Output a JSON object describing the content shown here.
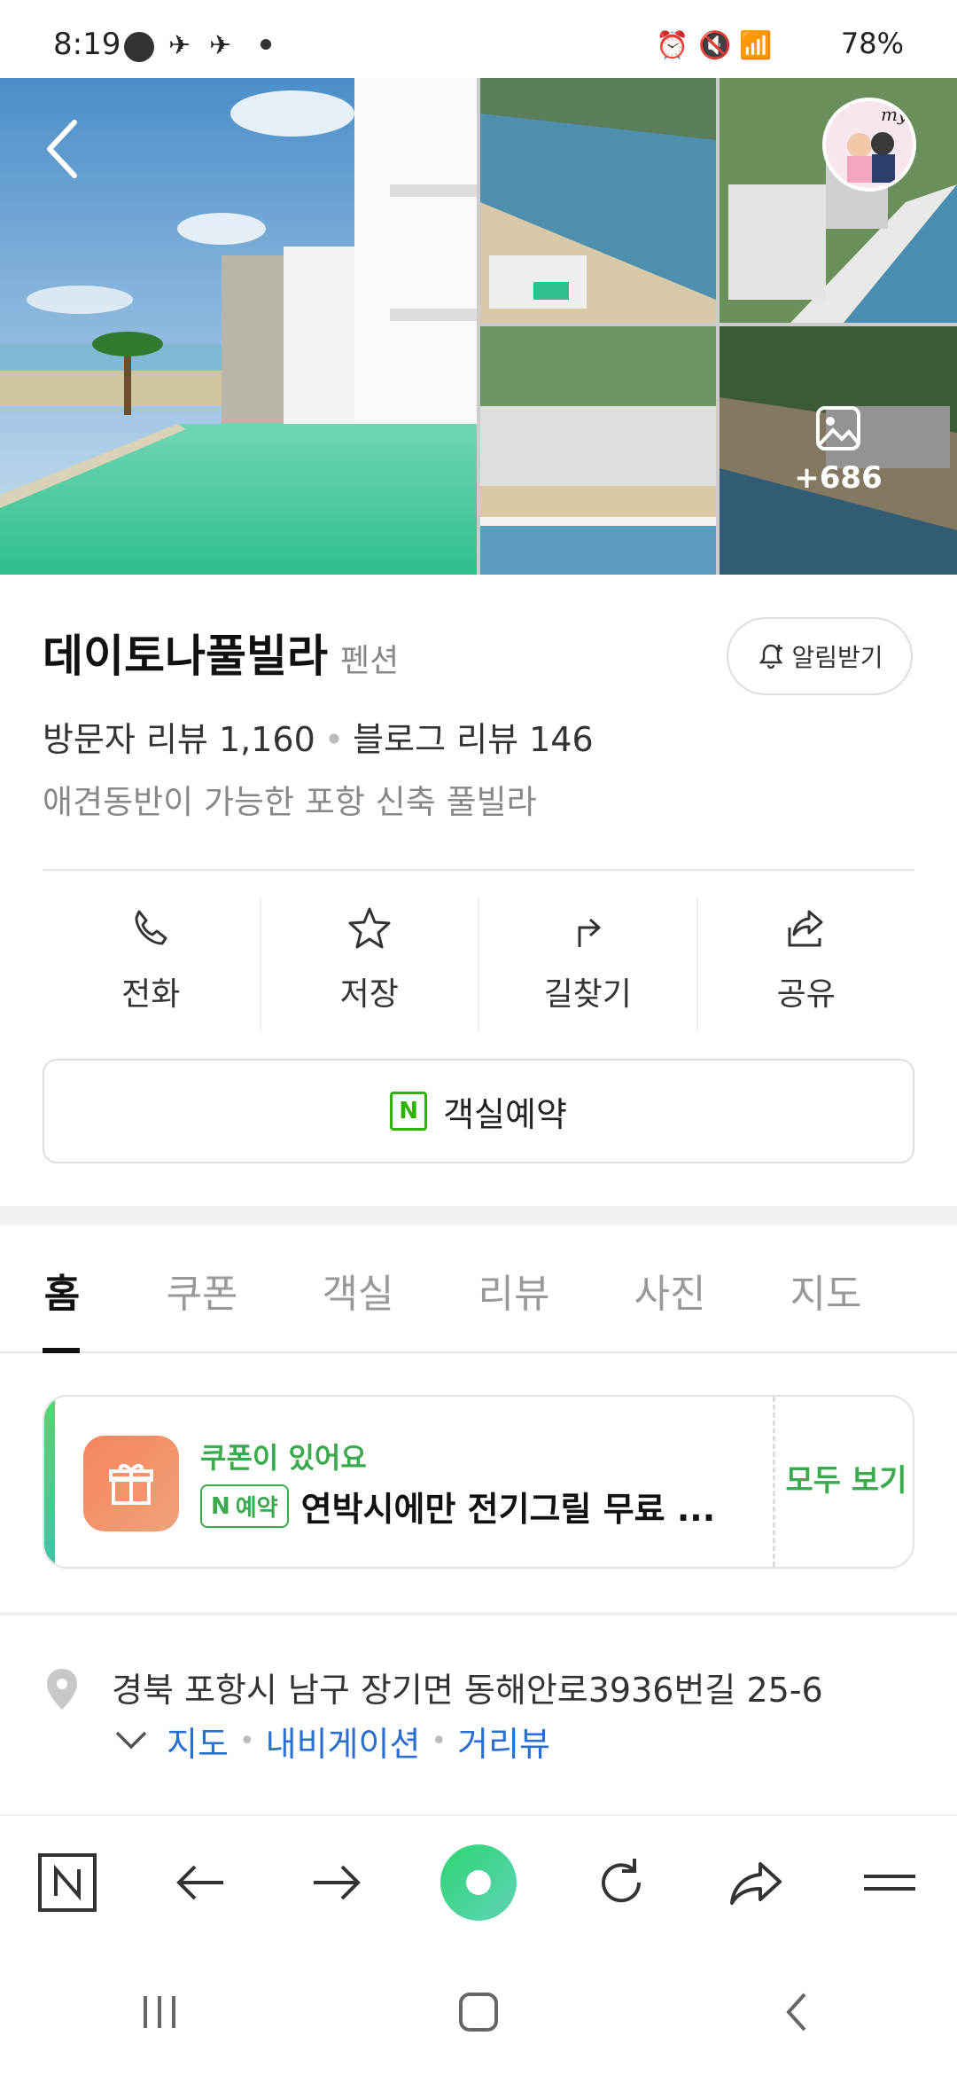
{
  "status_bar": {
    "time": "8:19",
    "battery": "78%"
  },
  "gallery": {
    "more_count": "+686"
  },
  "place": {
    "name": "데이토나풀빌라",
    "category": "펜션",
    "notify_label": "알림받기",
    "visitor_reviews": "방문자 리뷰 1,160",
    "blog_reviews": "블로그 리뷰 146",
    "description": "애견동반이 가능한 포항 신축 풀빌라"
  },
  "actions": [
    {
      "label": "전화",
      "icon": "phone-icon"
    },
    {
      "label": "저장",
      "icon": "star-icon"
    },
    {
      "label": "길찾기",
      "icon": "directions-icon"
    },
    {
      "label": "공유",
      "icon": "share-icon"
    }
  ],
  "reserve": {
    "label": "객실예약"
  },
  "tabs": [
    "홈",
    "쿠폰",
    "객실",
    "리뷰",
    "사진",
    "지도"
  ],
  "coupon": {
    "title": "쿠폰이 있어요",
    "badge": "예약",
    "text": "연박시에만 전기그릴 무료 ...",
    "view_all": "모두 보기"
  },
  "address": {
    "text": "경북 포항시 남구 장기면 동해안로3936번길 25-6",
    "links": [
      "지도",
      "내비게이션",
      "거리뷰"
    ]
  },
  "colors": {
    "accent_green": "#2db400",
    "link_blue": "#2a6fd0"
  }
}
